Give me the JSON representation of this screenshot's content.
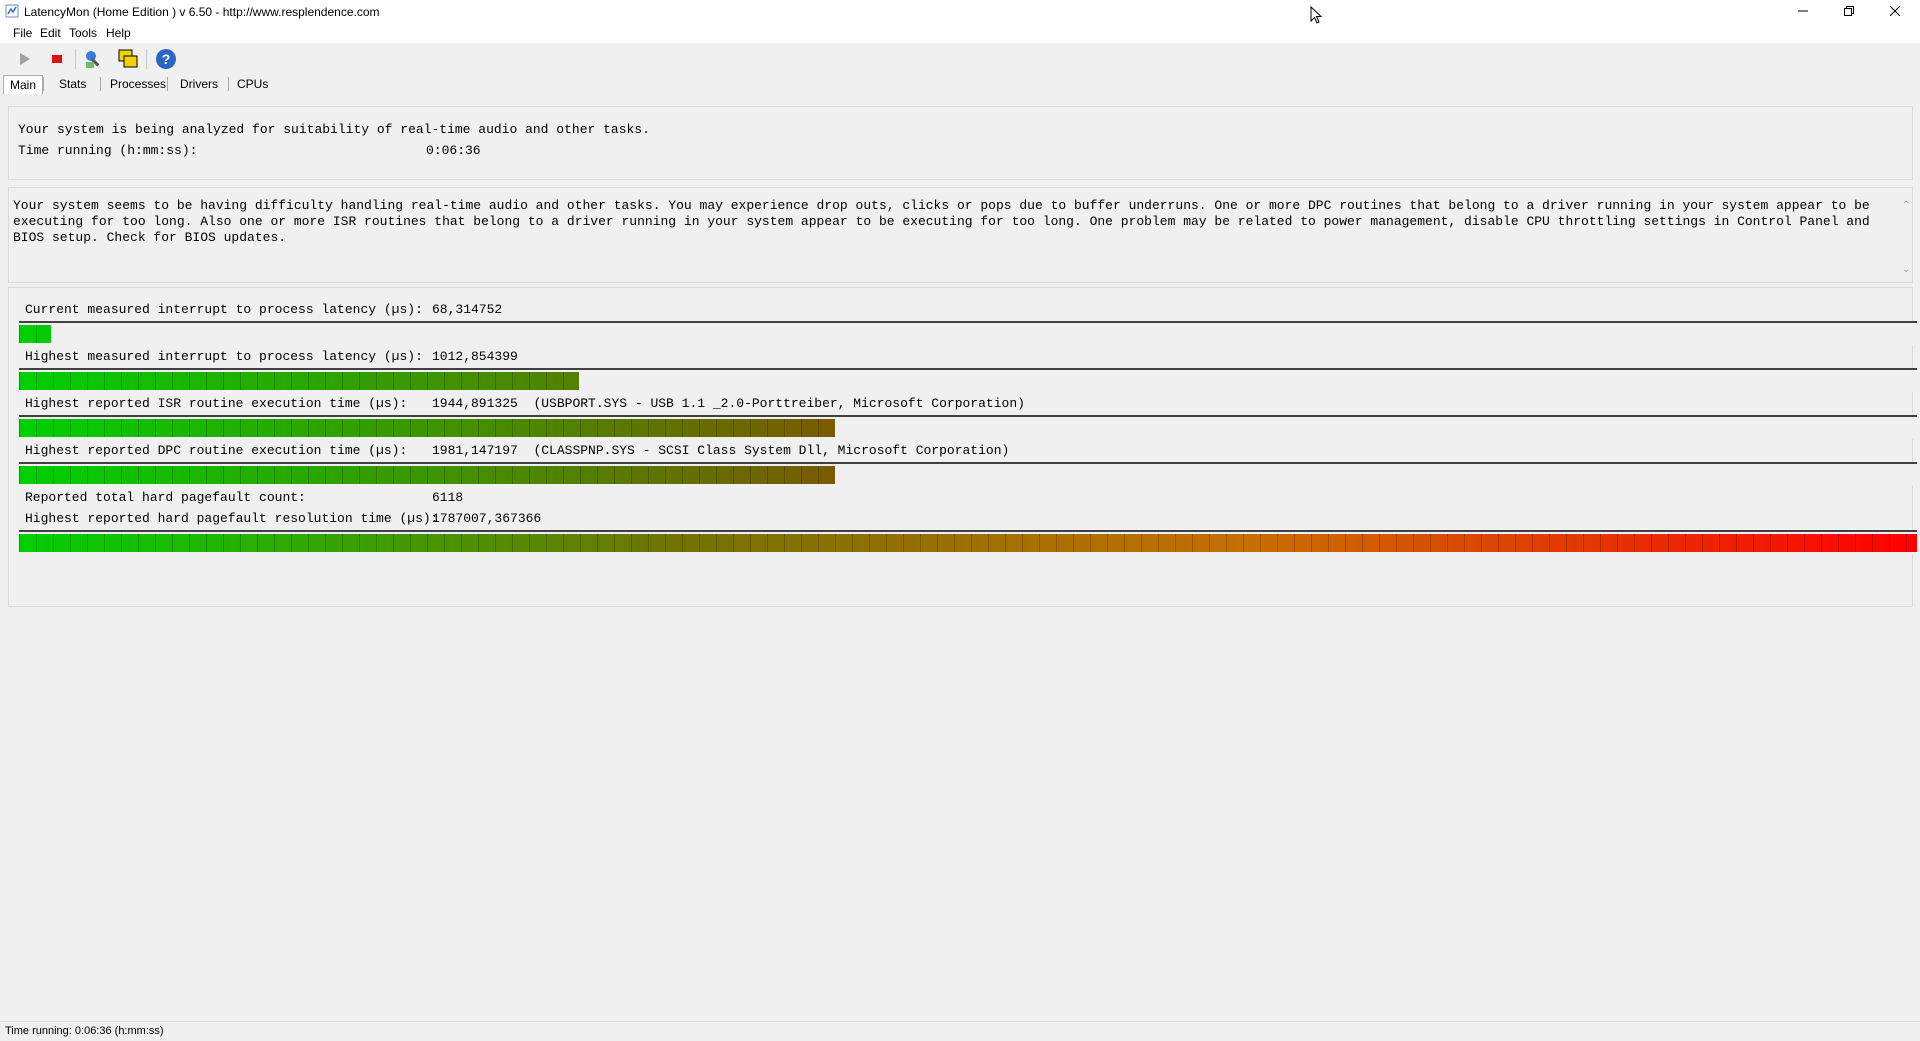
{
  "window": {
    "title": "LatencyMon  (Home Edition )  v 6.50 - http://www.resplendence.com",
    "minimize_icon": "minimize-icon",
    "restore_icon": "restore-icon",
    "close_icon": "close-icon"
  },
  "menu": [
    "File",
    "Edit",
    "Tools",
    "Help"
  ],
  "toolbar": {
    "buttons": [
      "play-icon",
      "stop-icon",
      "tools-icon",
      "windows-icon",
      "help-icon"
    ]
  },
  "tabs": [
    "Main",
    "Stats",
    "Processes",
    "Drivers",
    "CPUs"
  ],
  "status_top": {
    "line1": "Your system is being analyzed for suitability of real-time audio and other tasks.",
    "time_label": "Time running (h:mm:ss):",
    "time_value": "0:06:36"
  },
  "analysis_text": "Your system seems to be having difficulty handling real-time audio and other tasks. You may experience drop outs, clicks or pops due to buffer underruns. One or more DPC routines that belong to a driver running in your system appear to be executing for too long. Also one or more ISR routines that belong to a driver running in your system appear to be executing for too long. One problem may be related to power management, disable CPU throttling settings in Control Panel and BIOS setup. Check for BIOS updates.",
  "metrics": [
    {
      "label": "Current measured interrupt to process latency (µs):",
      "value": "68,314752",
      "level": 0.017
    },
    {
      "label": "Highest measured interrupt to process latency (µs):",
      "value": "1012,854399",
      "level": 0.295
    },
    {
      "label": "Highest reported ISR routine execution time (µs):",
      "value": "1944,891325",
      "detail": "(USBPORT.SYS - USB 1.1 _2.0-Porttreiber, Microsoft Corporation)",
      "level": 0.43
    },
    {
      "label": "Highest reported DPC routine execution time (µs):",
      "value": "1981,147197",
      "detail": "(CLASSPNP.SYS - SCSI Class System Dll, Microsoft Corporation)",
      "level": 0.43
    },
    {
      "label": "Reported total hard pagefault count:",
      "value": "6118"
    },
    {
      "label": "Highest reported hard pagefault resolution time (µs):",
      "value": "1787007,367366",
      "level": 1.0
    }
  ],
  "statusbar": "Time running: 0:06:36  (h:mm:ss)",
  "colors": {
    "green": "#00d000",
    "olive": "#7a5a00",
    "red": "#ff0000"
  }
}
